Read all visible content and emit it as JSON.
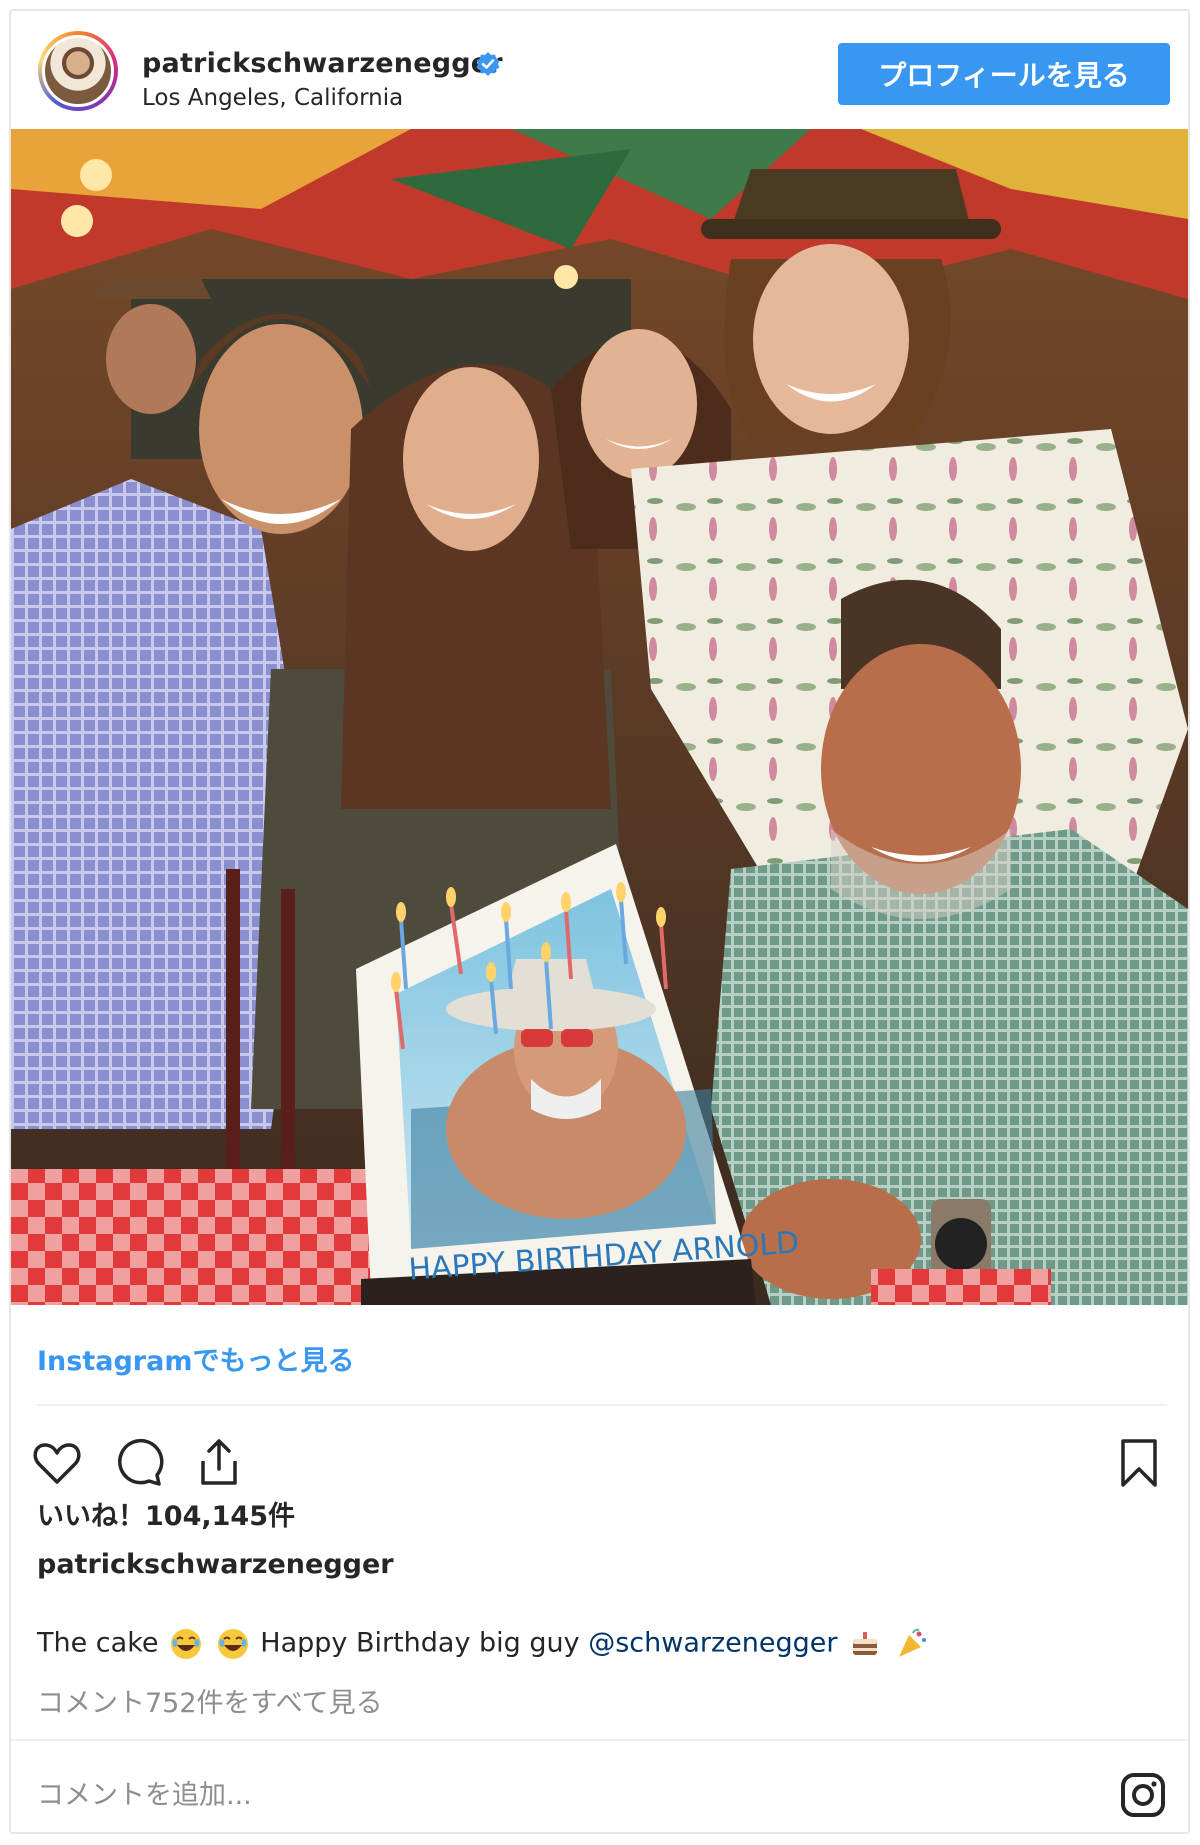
{
  "header": {
    "username": "patrickschwarzenegger",
    "location": "Los Angeles, California",
    "profile_button": "プロフィールを見る"
  },
  "photo": {
    "cake_text": "HAPPY BIRTHDAY ARNOLD"
  },
  "more_link": "Instagramでもっと見る",
  "likes": "いいね！104,145件",
  "caption": {
    "username": "patrickschwarzenegger",
    "text_start": "The cake",
    "text_mid": "Happy Birthday big guy",
    "mention": "@schwarzenegger"
  },
  "comments_link": "コメント752件をすべて見る",
  "comment_placeholder": "コメントを追加...",
  "icons": {
    "like": "heart-icon",
    "comment": "comment-icon",
    "share": "share-icon",
    "save": "bookmark-icon",
    "verified": "verified-badge-icon",
    "instagram": "instagram-logo-icon",
    "emoji_laugh": "laughing-emoji",
    "emoji_cake": "cake-emoji",
    "emoji_party": "party-popper-emoji"
  },
  "colors": {
    "accent": "#3897f0",
    "text": "#262626",
    "muted": "#8e8e8e",
    "mention": "#003569"
  }
}
